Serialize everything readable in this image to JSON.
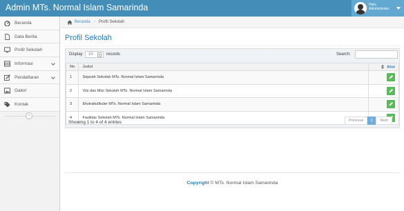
{
  "app": {
    "title": "Admin MTs. Normal Islam Samarinda"
  },
  "user": {
    "greeting": "Halo,",
    "name": "Administrator"
  },
  "sidebar": {
    "items": [
      {
        "label": "Beranda",
        "icon": "dashboard-icon"
      },
      {
        "label": "Data Berita",
        "icon": "file-icon"
      },
      {
        "label": "Profil Sekolah",
        "icon": "desktop-icon"
      },
      {
        "label": "Informasi",
        "icon": "list-icon"
      },
      {
        "label": "Pendaftaran",
        "icon": "edit-icon"
      },
      {
        "label": "Galeri",
        "icon": "picture-icon"
      },
      {
        "label": "Kontak",
        "icon": "tag-icon"
      }
    ],
    "collapse": "«"
  },
  "breadcrumb": {
    "home": "Beranda",
    "separator": "›",
    "current": "Profil Sekolah"
  },
  "page": {
    "title": "Profil Sekolah"
  },
  "table": {
    "display_label": "Display",
    "length_value": "10",
    "records_label": "records",
    "search_label": "Search:",
    "headers": {
      "no": "No",
      "judul": "Judul",
      "aksi": "Aksi"
    },
    "rows": [
      {
        "no": "1",
        "judul": "Sejarah Sekolah MTs. Normal Islam Samarinda"
      },
      {
        "no": "2",
        "judul": "Visi dan Misi Sekolah MTs. Normal Islam Samarinda"
      },
      {
        "no": "3",
        "judul": "Ekstrakulikuler MTs. Normal Islam Samarinda"
      },
      {
        "no": "4",
        "judul": "Fasilitas Sekolah MTs. Normal Islam Samarinda"
      }
    ],
    "info": "Showing 1 to 4 of 4 entries",
    "pagination": {
      "previous": "Previous",
      "current": "1",
      "next": "Next"
    }
  },
  "footer": {
    "copyright": "Copyright",
    "text": "© MTs. Normal Islam Samarinda"
  },
  "colors": {
    "navbar": "#438eb9",
    "accent": "#2679b5",
    "edit_button": "#5cb85c",
    "pager_active": "#6faed9"
  }
}
